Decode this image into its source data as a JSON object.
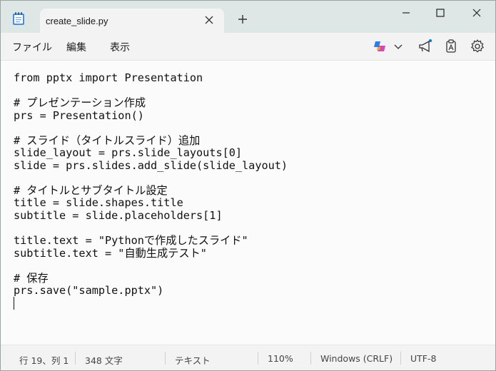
{
  "window": {
    "tab_title": "create_slide.py",
    "icons": {
      "app": "notepad-icon",
      "tab_close": "close-icon",
      "new_tab": "plus-icon",
      "minimize": "minimize-icon",
      "maximize": "maximize-icon",
      "close": "close-icon"
    }
  },
  "menubar": {
    "items": [
      "ファイル",
      "編集",
      "表示"
    ],
    "tools": [
      "copilot-icon",
      "chevron-down-icon",
      "megaphone-icon",
      "clipboard-icon",
      "gear-icon"
    ]
  },
  "editor": {
    "lines": [
      "from pptx import Presentation",
      "",
      "# プレゼンテーション作成",
      "prs = Presentation()",
      "",
      "# スライド（タイトルスライド）追加",
      "slide_layout = prs.slide_layouts[0]",
      "slide = prs.slides.add_slide(slide_layout)",
      "",
      "# タイトルとサブタイトル設定",
      "title = slide.shapes.title",
      "subtitle = slide.placeholders[1]",
      "",
      "title.text = \"Pythonで作成したスライド\"",
      "subtitle.text = \"自動生成テスト\"",
      "",
      "# 保存",
      "prs.save(\"sample.pptx\")",
      ""
    ]
  },
  "statusbar": {
    "position": "行 19、列 1",
    "char_count": "348 文字",
    "mode": "テキスト",
    "zoom": "110%",
    "line_ending": "Windows (CRLF)",
    "encoding": "UTF-8"
  },
  "colors": {
    "titlebar": "#dfe7e6",
    "accent": "#0067c0",
    "notification_dot": "#0078d4"
  }
}
